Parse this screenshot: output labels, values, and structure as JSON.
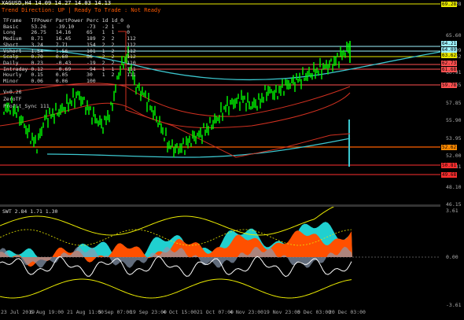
{
  "header": {
    "symbol_line": "XAGUSD,H4 14.09 14.27 14.03 14.13",
    "trend_direction_label": "Trend Direction:",
    "trend_direction_value": "UP",
    "ready_label": "Ready To Trade",
    "not_ready_label": "Not Ready"
  },
  "panel": {
    "columns": [
      "TFrame",
      "TFPower",
      "PartPower",
      "Perc",
      "1d",
      "1d_0"
    ],
    "rows": [
      [
        "Basic",
        "53.26",
        "-39.10",
        "-73",
        "-2",
        "1",
        "0"
      ],
      [
        "Long",
        "26.75",
        "14.16",
        "65",
        "1",
        "1",
        "0"
      ],
      [
        "Medium",
        "8.71",
        "16.45",
        "189",
        "2",
        "2",
        "112"
      ],
      [
        "Short",
        "3.24",
        "7.71",
        "154",
        "2",
        "2",
        "112"
      ],
      [
        "Vshort",
        "1.54",
        "1.56",
        "101",
        "1",
        "2",
        "112"
      ],
      [
        "Scalp",
        "0.70",
        "0.60",
        "86",
        "2",
        "2",
        "112"
      ],
      [
        "Daily",
        "0.23",
        "-0.43",
        "-19",
        "2",
        "2",
        "110"
      ],
      [
        "Intraday",
        "0.12",
        "-0.69",
        "-94",
        "1",
        "1",
        "111"
      ],
      [
        "Hourly",
        "0.15",
        "0.05",
        "30",
        "1",
        "2",
        "111"
      ],
      [
        "Minor",
        "0.06",
        "0.06",
        "100",
        "",
        "",
        ""
      ]
    ],
    "v_line": "V=0.26",
    "zero_label": "ZeroTF",
    "profit_label": "Profit_Sync 111"
  },
  "price_axis": {
    "labels": [
      "69.28",
      "65.60",
      "64.09",
      "63.62",
      "60.91",
      "59.65",
      "57.85",
      "55.90",
      "53.95",
      "52.00",
      "50.81",
      "48.10",
      "46.15"
    ],
    "tags": [
      {
        "text": "69.28",
        "color": "#e8e800"
      },
      {
        "text": "64.21",
        "color": "#9ef3ff"
      },
      {
        "text": "64.09",
        "color": "#9ef3ff"
      },
      {
        "text": "63.62",
        "color": "#e8e800"
      },
      {
        "text": "62.73",
        "color": "#ff5050"
      },
      {
        "text": "61.68",
        "color": "#ff5050"
      },
      {
        "text": "59.78",
        "color": "#ff5050"
      },
      {
        "text": "52.62",
        "color": "#ff8a00"
      },
      {
        "text": "50.81",
        "color": "#ff3030"
      },
      {
        "text": "49.68",
        "color": "#ff3030"
      }
    ]
  },
  "sub": {
    "title": "SWT 2.84 1.71 1.30",
    "axis": [
      "3.61",
      "0.00",
      "-3.61"
    ]
  },
  "time_axis": [
    "23 Jul 2019",
    "6 Aug 19:00",
    "21 Aug 11:00",
    "5 Sep 07:00",
    "19 Sep 23:00",
    "4 Oct 15:00",
    "21 Oct 07:00",
    "4 Nov 23:00",
    "19 Nov 23:00",
    "5 Dec 03:00",
    "20 Dec 03:00"
  ],
  "colors": {
    "candle": "#00ff00",
    "ma_cyan": "#3cc8d0",
    "red": "#d03020",
    "orange": "#ff6000",
    "yellow": "#e8e800",
    "swt_fill_cyan": "#20d0d0",
    "swt_fill_orange": "#ff5000"
  }
}
